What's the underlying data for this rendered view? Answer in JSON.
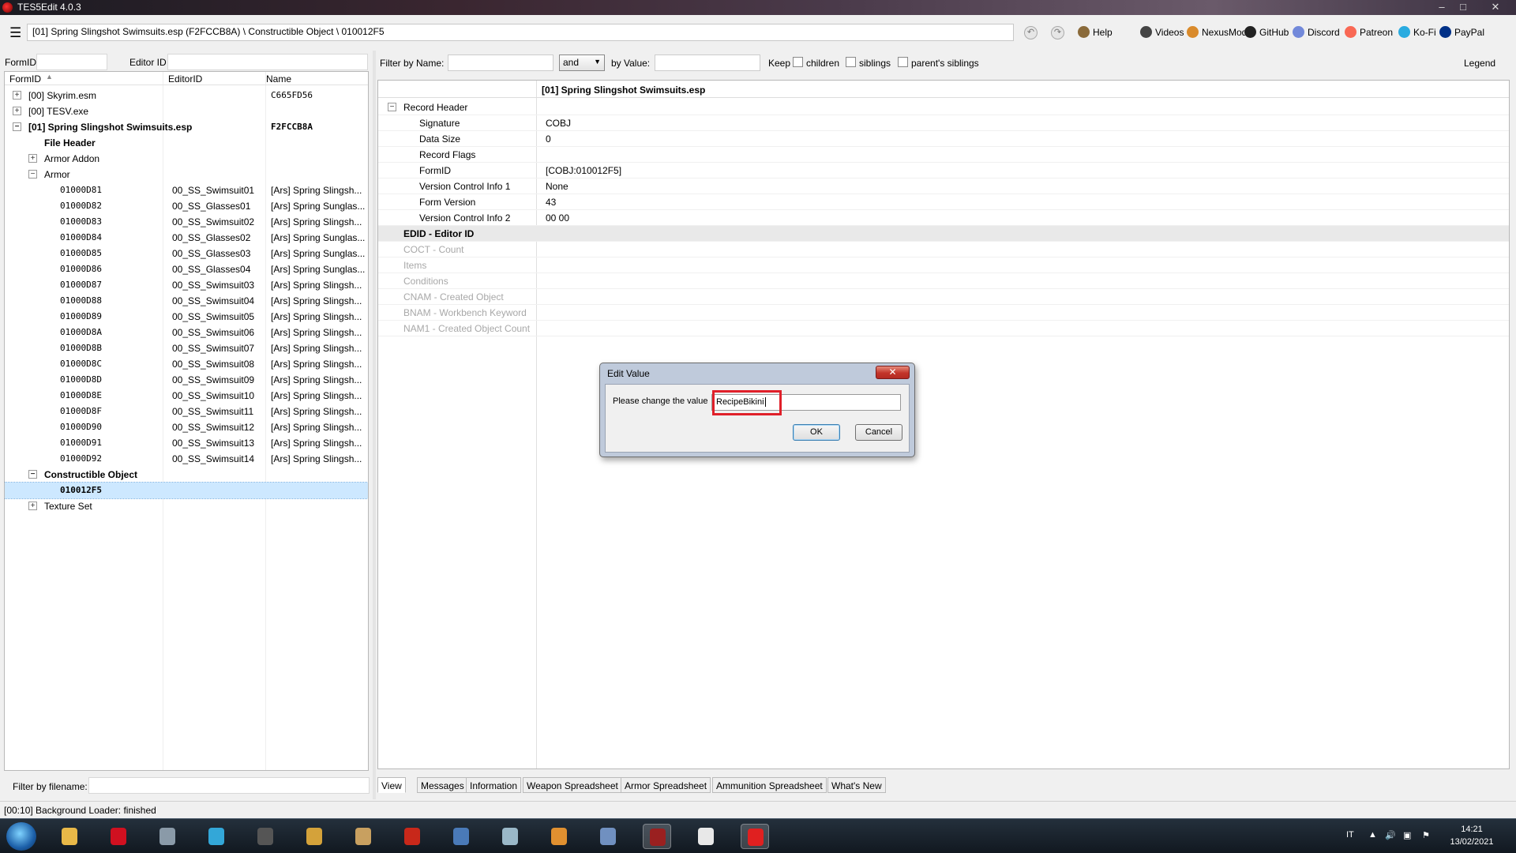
{
  "window": {
    "title": "TES5Edit 4.0.3"
  },
  "toolbar": {
    "path": "[01] Spring Slingshot Swimsuits.esp (F2FCCB8A) \\ Constructible Object \\ 010012F5",
    "links": [
      {
        "label": "Help",
        "icon": "book-icon",
        "color": "#8a6a3a"
      },
      {
        "label": "Videos",
        "icon": "film-icon",
        "color": "#444444"
      },
      {
        "label": "NexusMods",
        "icon": "nexus-icon",
        "color": "#d98a2b"
      },
      {
        "label": "GitHub",
        "icon": "github-icon",
        "color": "#222222"
      },
      {
        "label": "Discord",
        "icon": "discord-icon",
        "color": "#7289da"
      },
      {
        "label": "Patreon",
        "icon": "patreon-icon",
        "color": "#f96854"
      },
      {
        "label": "Ko-Fi",
        "icon": "kofi-icon",
        "color": "#29abe0"
      },
      {
        "label": "PayPal",
        "icon": "paypal-icon",
        "color": "#003087"
      }
    ]
  },
  "left": {
    "formid_label": "FormID",
    "editorid_label": "Editor ID",
    "columns": {
      "formid": "FormID",
      "editorid": "EditorID",
      "name": "Name"
    },
    "filter_filename_label": "Filter by filename:",
    "tree": [
      {
        "formid": "[00] Skyrim.esm",
        "editorid": "",
        "name": "C665FD56",
        "level": 0,
        "expander": "+",
        "bold": false
      },
      {
        "formid": "[00] TESV.exe",
        "editorid": "",
        "name": "",
        "level": 0,
        "expander": "+",
        "bold": false
      },
      {
        "formid": "[01] Spring Slingshot Swimsuits.esp",
        "editorid": "",
        "name": "F2FCCB8A",
        "level": 0,
        "expander": "-",
        "bold": true
      },
      {
        "formid": "File Header",
        "editorid": "",
        "name": "",
        "level": 1,
        "expander": "",
        "bold": true
      },
      {
        "formid": "Armor Addon",
        "editorid": "",
        "name": "",
        "level": 1,
        "expander": "+",
        "bold": false
      },
      {
        "formid": "Armor",
        "editorid": "",
        "name": "",
        "level": 1,
        "expander": "-",
        "bold": false
      },
      {
        "formid": "01000D81",
        "editorid": "00_SS_Swimsuit01",
        "name": "[Ars] Spring Slingsh...",
        "level": 2,
        "expander": "",
        "bold": false
      },
      {
        "formid": "01000D82",
        "editorid": "00_SS_Glasses01",
        "name": "[Ars] Spring Sunglas...",
        "level": 2,
        "expander": "",
        "bold": false
      },
      {
        "formid": "01000D83",
        "editorid": "00_SS_Swimsuit02",
        "name": "[Ars] Spring Slingsh...",
        "level": 2,
        "expander": "",
        "bold": false
      },
      {
        "formid": "01000D84",
        "editorid": "00_SS_Glasses02",
        "name": "[Ars] Spring Sunglas...",
        "level": 2,
        "expander": "",
        "bold": false
      },
      {
        "formid": "01000D85",
        "editorid": "00_SS_Glasses03",
        "name": "[Ars] Spring Sunglas...",
        "level": 2,
        "expander": "",
        "bold": false
      },
      {
        "formid": "01000D86",
        "editorid": "00_SS_Glasses04",
        "name": "[Ars] Spring Sunglas...",
        "level": 2,
        "expander": "",
        "bold": false
      },
      {
        "formid": "01000D87",
        "editorid": "00_SS_Swimsuit03",
        "name": "[Ars] Spring Slingsh...",
        "level": 2,
        "expander": "",
        "bold": false
      },
      {
        "formid": "01000D88",
        "editorid": "00_SS_Swimsuit04",
        "name": "[Ars] Spring Slingsh...",
        "level": 2,
        "expander": "",
        "bold": false
      },
      {
        "formid": "01000D89",
        "editorid": "00_SS_Swimsuit05",
        "name": "[Ars] Spring Slingsh...",
        "level": 2,
        "expander": "",
        "bold": false
      },
      {
        "formid": "01000D8A",
        "editorid": "00_SS_Swimsuit06",
        "name": "[Ars] Spring Slingsh...",
        "level": 2,
        "expander": "",
        "bold": false
      },
      {
        "formid": "01000D8B",
        "editorid": "00_SS_Swimsuit07",
        "name": "[Ars] Spring Slingsh...",
        "level": 2,
        "expander": "",
        "bold": false
      },
      {
        "formid": "01000D8C",
        "editorid": "00_SS_Swimsuit08",
        "name": "[Ars] Spring Slingsh...",
        "level": 2,
        "expander": "",
        "bold": false
      },
      {
        "formid": "01000D8D",
        "editorid": "00_SS_Swimsuit09",
        "name": "[Ars] Spring Slingsh...",
        "level": 2,
        "expander": "",
        "bold": false
      },
      {
        "formid": "01000D8E",
        "editorid": "00_SS_Swimsuit10",
        "name": "[Ars] Spring Slingsh...",
        "level": 2,
        "expander": "",
        "bold": false
      },
      {
        "formid": "01000D8F",
        "editorid": "00_SS_Swimsuit11",
        "name": "[Ars] Spring Slingsh...",
        "level": 2,
        "expander": "",
        "bold": false
      },
      {
        "formid": "01000D90",
        "editorid": "00_SS_Swimsuit12",
        "name": "[Ars] Spring Slingsh...",
        "level": 2,
        "expander": "",
        "bold": false
      },
      {
        "formid": "01000D91",
        "editorid": "00_SS_Swimsuit13",
        "name": "[Ars] Spring Slingsh...",
        "level": 2,
        "expander": "",
        "bold": false
      },
      {
        "formid": "01000D92",
        "editorid": "00_SS_Swimsuit14",
        "name": "[Ars] Spring Slingsh...",
        "level": 2,
        "expander": "",
        "bold": false
      },
      {
        "formid": "Constructible Object",
        "editorid": "",
        "name": "",
        "level": 1,
        "expander": "-",
        "bold": true
      },
      {
        "formid": "010012F5",
        "editorid": "",
        "name": "",
        "level": 2,
        "expander": "",
        "bold": true,
        "selected": true
      },
      {
        "formid": "Texture Set",
        "editorid": "",
        "name": "",
        "level": 1,
        "expander": "+",
        "bold": false
      }
    ]
  },
  "right": {
    "filter_by_name_label": "Filter by Name:",
    "operator": "and",
    "by_value_label": "by Value:",
    "keep_label": "Keep",
    "children_label": "children",
    "siblings_label": "siblings",
    "parents_siblings_label": "parent's siblings",
    "legend_label": "Legend",
    "file_header": "[01] Spring Slingshot Swimsuits.esp",
    "rows": [
      {
        "label": "Record Header",
        "value": "",
        "level": 0,
        "expander": "-",
        "style": "normal"
      },
      {
        "label": "Signature",
        "value": "COBJ",
        "level": 1,
        "expander": "",
        "style": "normal"
      },
      {
        "label": "Data Size",
        "value": "0",
        "level": 1,
        "expander": "",
        "style": "normal"
      },
      {
        "label": "Record Flags",
        "value": "",
        "level": 1,
        "expander": "",
        "style": "normal"
      },
      {
        "label": "FormID",
        "value": "[COBJ:010012F5]",
        "level": 1,
        "expander": "",
        "style": "normal"
      },
      {
        "label": "Version Control Info 1",
        "value": "None",
        "level": 1,
        "expander": "",
        "style": "normal"
      },
      {
        "label": "Form Version",
        "value": "43",
        "level": 1,
        "expander": "",
        "style": "normal"
      },
      {
        "label": "Version Control Info 2",
        "value": "00 00",
        "level": 1,
        "expander": "",
        "style": "normal"
      },
      {
        "label": "EDID - Editor ID",
        "value": "",
        "level": 0,
        "expander": "",
        "style": "highlight"
      },
      {
        "label": "COCT - Count",
        "value": "",
        "level": 0,
        "expander": "",
        "style": "dim"
      },
      {
        "label": "Items",
        "value": "",
        "level": 0,
        "expander": "",
        "style": "dim"
      },
      {
        "label": "Conditions",
        "value": "",
        "level": 0,
        "expander": "",
        "style": "dim"
      },
      {
        "label": "CNAM - Created Object",
        "value": "",
        "level": 0,
        "expander": "",
        "style": "dim"
      },
      {
        "label": "BNAM - Workbench Keyword",
        "value": "",
        "level": 0,
        "expander": "",
        "style": "dim"
      },
      {
        "label": "NAM1 - Created Object Count",
        "value": "",
        "level": 0,
        "expander": "",
        "style": "dim"
      }
    ],
    "tabs": [
      "View",
      "Messages",
      "Information",
      "Weapon Spreadsheet",
      "Armor Spreadsheet",
      "Ammunition Spreadsheet",
      "What's New"
    ]
  },
  "dialog": {
    "title": "Edit Value",
    "prompt": "Please change the value",
    "value": "RecipeBikini",
    "ok_label": "OK",
    "cancel_label": "Cancel",
    "highlight_color": "#e0202a"
  },
  "status": {
    "text": "[00:10] Background Loader: finished"
  },
  "taskbar": {
    "apps": [
      {
        "icon": "explorer-icon",
        "color": "#e8b848"
      },
      {
        "icon": "opera-icon",
        "color": "#d01020"
      },
      {
        "icon": "media-center-icon",
        "color": "#8a9aa8"
      },
      {
        "icon": "music-icon",
        "color": "#33a7d8"
      },
      {
        "icon": "speaker-icon",
        "color": "#555555"
      },
      {
        "icon": "mod-organizer-icon",
        "color": "#d4a23a"
      },
      {
        "icon": "banner-icon",
        "color": "#c8a060"
      },
      {
        "icon": "filezilla-icon",
        "color": "#c8281a"
      },
      {
        "icon": "ffdec-icon",
        "color": "#4a7ab8"
      },
      {
        "icon": "notepad-icon",
        "color": "#9ab8c8"
      },
      {
        "icon": "puzzle-icon",
        "color": "#e09030"
      },
      {
        "icon": "quill-icon",
        "color": "#7090c0"
      },
      {
        "icon": "tes5edit-icon",
        "color": "#9a2020",
        "active": true
      },
      {
        "icon": "people-icon",
        "color": "#e8e8e8"
      },
      {
        "icon": "opera-gx-icon",
        "color": "#e02020",
        "active": true
      }
    ],
    "lang": "IT",
    "time": "14:21",
    "date": "13/02/2021"
  }
}
